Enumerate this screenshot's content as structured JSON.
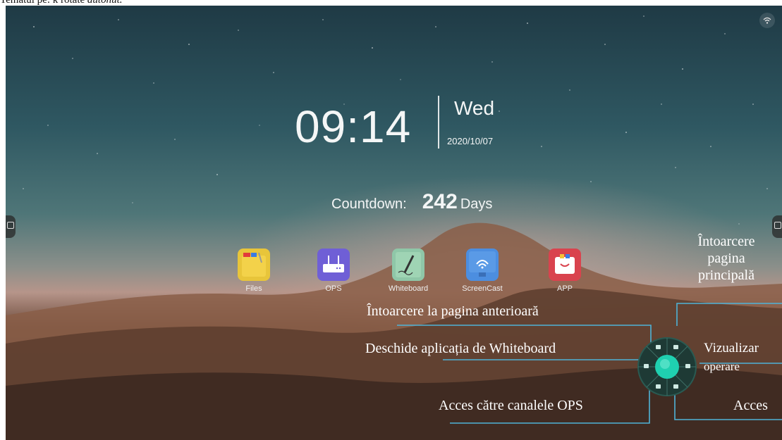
{
  "header": {
    "text_normal": "Tematul pe: k rotate ",
    "text_italic": "autonut."
  },
  "status": {
    "wifi_icon": "wifi-icon"
  },
  "clock": {
    "time": "09:14",
    "day": "Wed",
    "date": "2020/10/07"
  },
  "countdown": {
    "label": "Countdown:",
    "value": "242",
    "unit": "Days"
  },
  "apps": [
    {
      "label": "Files",
      "icon": "folder-icon",
      "color": "#e8c53a"
    },
    {
      "label": "OPS",
      "icon": "router-icon",
      "color": "#6f5fd6"
    },
    {
      "label": "Whiteboard",
      "icon": "whiteboard-icon",
      "color": "#8fc7a8"
    },
    {
      "label": "ScreenCast",
      "icon": "screencast-icon",
      "color": "#4c8ee0"
    },
    {
      "label": "APP",
      "icon": "app-store-icon",
      "color": "#d9434e"
    }
  ],
  "annotations": {
    "home": "Întoarcere\npagina\nprincipală",
    "back": "Întoarcere la pagina anterioară",
    "whiteboard": "Deschide aplicația de Whiteboard",
    "view": "Vizualizar\noperare",
    "ops": "Acces către canalele OPS",
    "access": "Acces"
  },
  "colors": {
    "accent": "#1fd0b0",
    "line": "#4fb3d8"
  }
}
